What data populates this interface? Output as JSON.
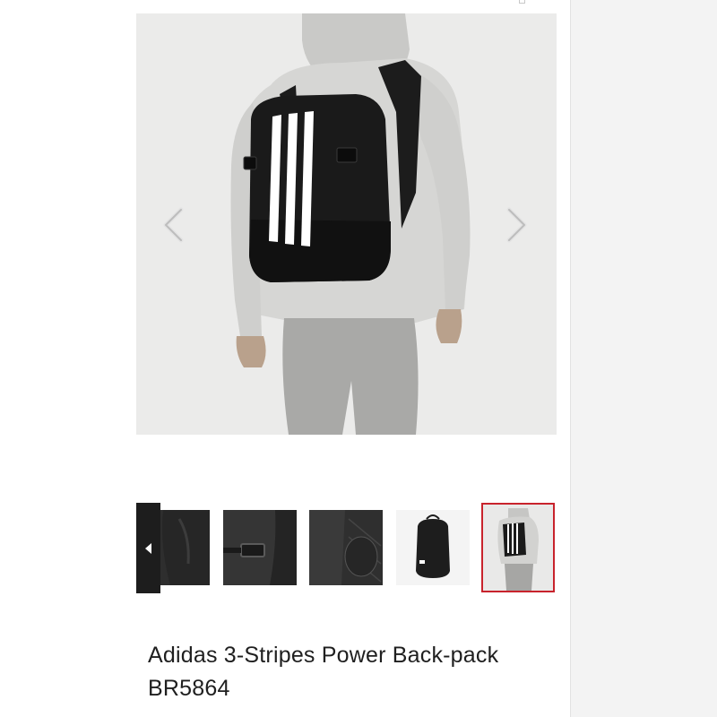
{
  "product": {
    "title": "Adidas 3-Stripes Power Back-pack BR5864",
    "image_alt": "Model wearing black backpack with three white stripes"
  },
  "gallery": {
    "prev_icon": "chevron-left-icon",
    "next_icon": "chevron-right-icon",
    "thumbnails": [
      {
        "name": "thumbnail-detail-front"
      },
      {
        "name": "thumbnail-detail-strap"
      },
      {
        "name": "thumbnail-detail-back"
      },
      {
        "name": "thumbnail-backpack-front"
      },
      {
        "name": "thumbnail-model-wearing"
      }
    ],
    "selected_index": 4
  },
  "colors": {
    "accent": "#c8232c",
    "backpack": "#1a1a1a",
    "stripes": "#ffffff",
    "hoodie": "#d4d4d2",
    "pants": "#a8a8a6"
  }
}
